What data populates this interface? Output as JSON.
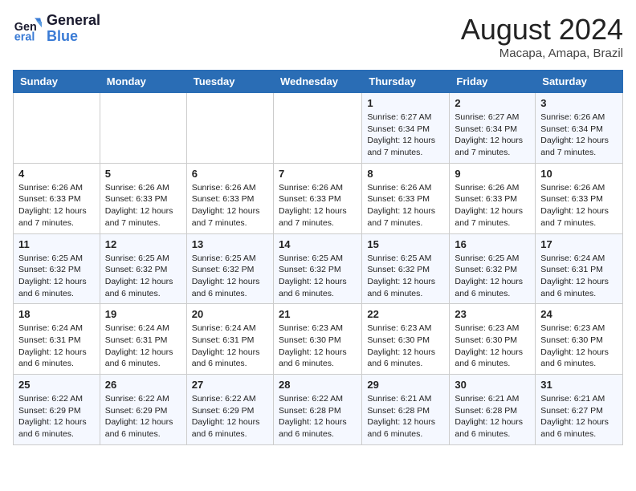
{
  "header": {
    "logo_general": "General",
    "logo_blue": "Blue",
    "month_year": "August 2024",
    "location": "Macapa, Amapa, Brazil"
  },
  "weekdays": [
    "Sunday",
    "Monday",
    "Tuesday",
    "Wednesday",
    "Thursday",
    "Friday",
    "Saturday"
  ],
  "weeks": [
    [
      {
        "day": "",
        "info": ""
      },
      {
        "day": "",
        "info": ""
      },
      {
        "day": "",
        "info": ""
      },
      {
        "day": "",
        "info": ""
      },
      {
        "day": "1",
        "info": "Sunrise: 6:27 AM\nSunset: 6:34 PM\nDaylight: 12 hours and 7 minutes."
      },
      {
        "day": "2",
        "info": "Sunrise: 6:27 AM\nSunset: 6:34 PM\nDaylight: 12 hours and 7 minutes."
      },
      {
        "day": "3",
        "info": "Sunrise: 6:26 AM\nSunset: 6:34 PM\nDaylight: 12 hours and 7 minutes."
      }
    ],
    [
      {
        "day": "4",
        "info": "Sunrise: 6:26 AM\nSunset: 6:33 PM\nDaylight: 12 hours and 7 minutes."
      },
      {
        "day": "5",
        "info": "Sunrise: 6:26 AM\nSunset: 6:33 PM\nDaylight: 12 hours and 7 minutes."
      },
      {
        "day": "6",
        "info": "Sunrise: 6:26 AM\nSunset: 6:33 PM\nDaylight: 12 hours and 7 minutes."
      },
      {
        "day": "7",
        "info": "Sunrise: 6:26 AM\nSunset: 6:33 PM\nDaylight: 12 hours and 7 minutes."
      },
      {
        "day": "8",
        "info": "Sunrise: 6:26 AM\nSunset: 6:33 PM\nDaylight: 12 hours and 7 minutes."
      },
      {
        "day": "9",
        "info": "Sunrise: 6:26 AM\nSunset: 6:33 PM\nDaylight: 12 hours and 7 minutes."
      },
      {
        "day": "10",
        "info": "Sunrise: 6:26 AM\nSunset: 6:33 PM\nDaylight: 12 hours and 7 minutes."
      }
    ],
    [
      {
        "day": "11",
        "info": "Sunrise: 6:25 AM\nSunset: 6:32 PM\nDaylight: 12 hours and 6 minutes."
      },
      {
        "day": "12",
        "info": "Sunrise: 6:25 AM\nSunset: 6:32 PM\nDaylight: 12 hours and 6 minutes."
      },
      {
        "day": "13",
        "info": "Sunrise: 6:25 AM\nSunset: 6:32 PM\nDaylight: 12 hours and 6 minutes."
      },
      {
        "day": "14",
        "info": "Sunrise: 6:25 AM\nSunset: 6:32 PM\nDaylight: 12 hours and 6 minutes."
      },
      {
        "day": "15",
        "info": "Sunrise: 6:25 AM\nSunset: 6:32 PM\nDaylight: 12 hours and 6 minutes."
      },
      {
        "day": "16",
        "info": "Sunrise: 6:25 AM\nSunset: 6:32 PM\nDaylight: 12 hours and 6 minutes."
      },
      {
        "day": "17",
        "info": "Sunrise: 6:24 AM\nSunset: 6:31 PM\nDaylight: 12 hours and 6 minutes."
      }
    ],
    [
      {
        "day": "18",
        "info": "Sunrise: 6:24 AM\nSunset: 6:31 PM\nDaylight: 12 hours and 6 minutes."
      },
      {
        "day": "19",
        "info": "Sunrise: 6:24 AM\nSunset: 6:31 PM\nDaylight: 12 hours and 6 minutes."
      },
      {
        "day": "20",
        "info": "Sunrise: 6:24 AM\nSunset: 6:31 PM\nDaylight: 12 hours and 6 minutes."
      },
      {
        "day": "21",
        "info": "Sunrise: 6:23 AM\nSunset: 6:30 PM\nDaylight: 12 hours and 6 minutes."
      },
      {
        "day": "22",
        "info": "Sunrise: 6:23 AM\nSunset: 6:30 PM\nDaylight: 12 hours and 6 minutes."
      },
      {
        "day": "23",
        "info": "Sunrise: 6:23 AM\nSunset: 6:30 PM\nDaylight: 12 hours and 6 minutes."
      },
      {
        "day": "24",
        "info": "Sunrise: 6:23 AM\nSunset: 6:30 PM\nDaylight: 12 hours and 6 minutes."
      }
    ],
    [
      {
        "day": "25",
        "info": "Sunrise: 6:22 AM\nSunset: 6:29 PM\nDaylight: 12 hours and 6 minutes."
      },
      {
        "day": "26",
        "info": "Sunrise: 6:22 AM\nSunset: 6:29 PM\nDaylight: 12 hours and 6 minutes."
      },
      {
        "day": "27",
        "info": "Sunrise: 6:22 AM\nSunset: 6:29 PM\nDaylight: 12 hours and 6 minutes."
      },
      {
        "day": "28",
        "info": "Sunrise: 6:22 AM\nSunset: 6:28 PM\nDaylight: 12 hours and 6 minutes."
      },
      {
        "day": "29",
        "info": "Sunrise: 6:21 AM\nSunset: 6:28 PM\nDaylight: 12 hours and 6 minutes."
      },
      {
        "day": "30",
        "info": "Sunrise: 6:21 AM\nSunset: 6:28 PM\nDaylight: 12 hours and 6 minutes."
      },
      {
        "day": "31",
        "info": "Sunrise: 6:21 AM\nSunset: 6:27 PM\nDaylight: 12 hours and 6 minutes."
      }
    ]
  ]
}
